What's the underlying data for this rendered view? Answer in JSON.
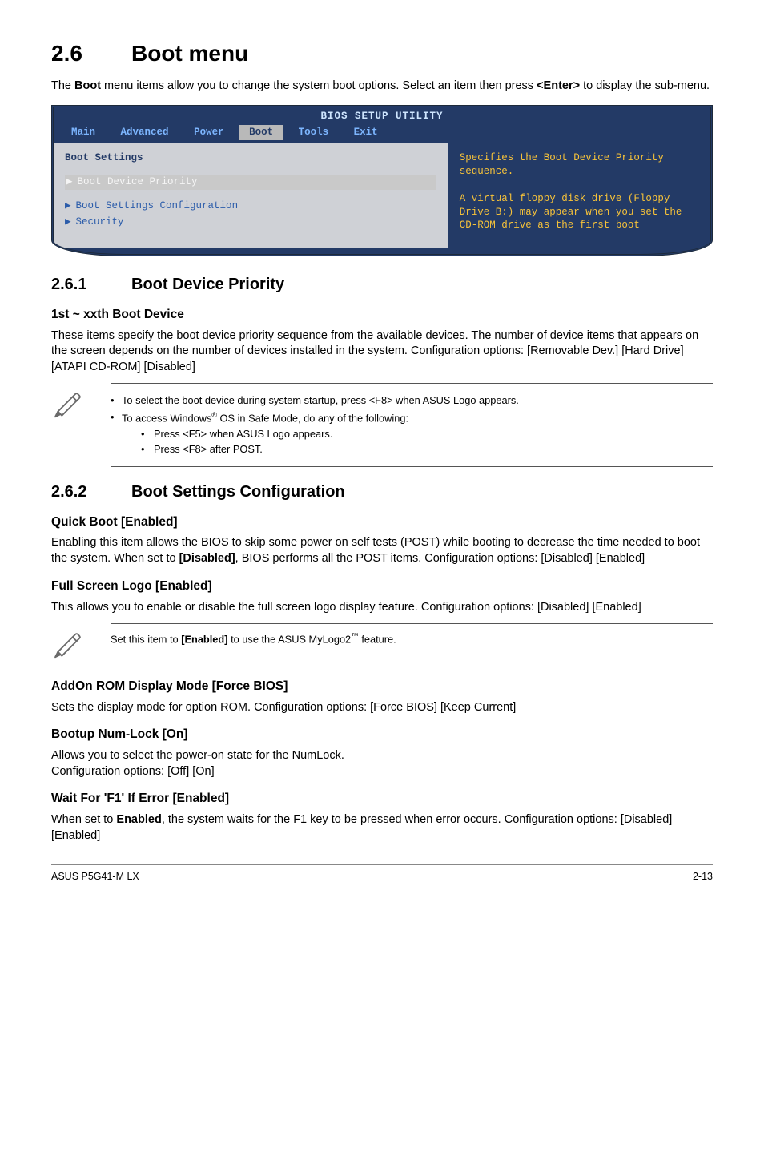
{
  "section": {
    "number": "2.6",
    "title": "Boot menu",
    "intro_pre": "The ",
    "intro_bold1": "Boot",
    "intro_mid": " menu items allow you to change the system boot options. Select an item then press ",
    "intro_bold2": "<Enter>",
    "intro_post": " to display the sub-menu."
  },
  "bios": {
    "header": "BIOS SETUP UTILITY",
    "tabs": [
      "Main",
      "Advanced",
      "Power",
      "Boot",
      "Tools",
      "Exit"
    ],
    "selected_tab": "Boot",
    "left_heading": "Boot Settings",
    "rows": [
      {
        "label": "Boot Device Priority",
        "selected": true
      },
      {
        "label": "Boot Settings Configuration",
        "selected": false
      },
      {
        "label": "Security",
        "selected": false
      }
    ],
    "right_text": "Specifies the Boot Device Priority sequence.\n\nA virtual floppy disk drive (Floppy Drive B:) may appear when you set the CD-ROM drive as the first boot"
  },
  "s261": {
    "number": "2.6.1",
    "title": "Boot Device Priority",
    "h3": "1st ~ xxth Boot Device",
    "body": "These items specify the boot device priority sequence from the available devices. The number of device items that appears on the screen depends on the number of devices installed in the system. Configuration options: [Removable Dev.] [Hard Drive]\n[ATAPI CD-ROM] [Disabled]"
  },
  "note1": {
    "b1": "To select the boot device during system startup, press <F8> when ASUS Logo appears.",
    "b2_pre": "To access Windows",
    "b2_post": " OS in Safe Mode, do any of the following:",
    "sub1": "Press <F5> when ASUS Logo appears.",
    "sub2": "Press <F8> after POST."
  },
  "s262": {
    "number": "2.6.2",
    "title": "Boot Settings Configuration",
    "qb_h": "Quick Boot [Enabled]",
    "qb_body_pre": "Enabling this item allows the BIOS to skip some power on self tests (POST) while booting to decrease the time needed to boot the system. When set to ",
    "qb_body_bold": "[Disabled]",
    "qb_body_post": ", BIOS performs all the POST items. Configuration options: [Disabled] [Enabled]",
    "fs_h": "Full Screen Logo [Enabled]",
    "fs_body": "This allows you to enable or disable the full screen logo display feature. Configuration options: [Disabled] [Enabled]",
    "note2_pre": "Set this item to ",
    "note2_bold": "[Enabled]",
    "note2_mid": " to use the ASUS MyLogo2",
    "note2_post": " feature.",
    "ar_h": "AddOn ROM Display Mode [Force BIOS]",
    "ar_body": "Sets the display mode for option ROM. Configuration options: [Force BIOS] [Keep Current]",
    "bn_h": "Bootup Num-Lock [On]",
    "bn_body": "Allows you to select the power-on state for the NumLock.\nConfiguration options: [Off] [On]",
    "wf_h": "Wait For 'F1' If Error [Enabled]",
    "wf_body_pre": "When set to ",
    "wf_body_bold": "Enabled",
    "wf_body_post": ", the system waits for the F1 key to be pressed when error occurs. Configuration options: [Disabled] [Enabled]"
  },
  "footer": {
    "left": "ASUS P5G41-M LX",
    "right": "2-13"
  }
}
